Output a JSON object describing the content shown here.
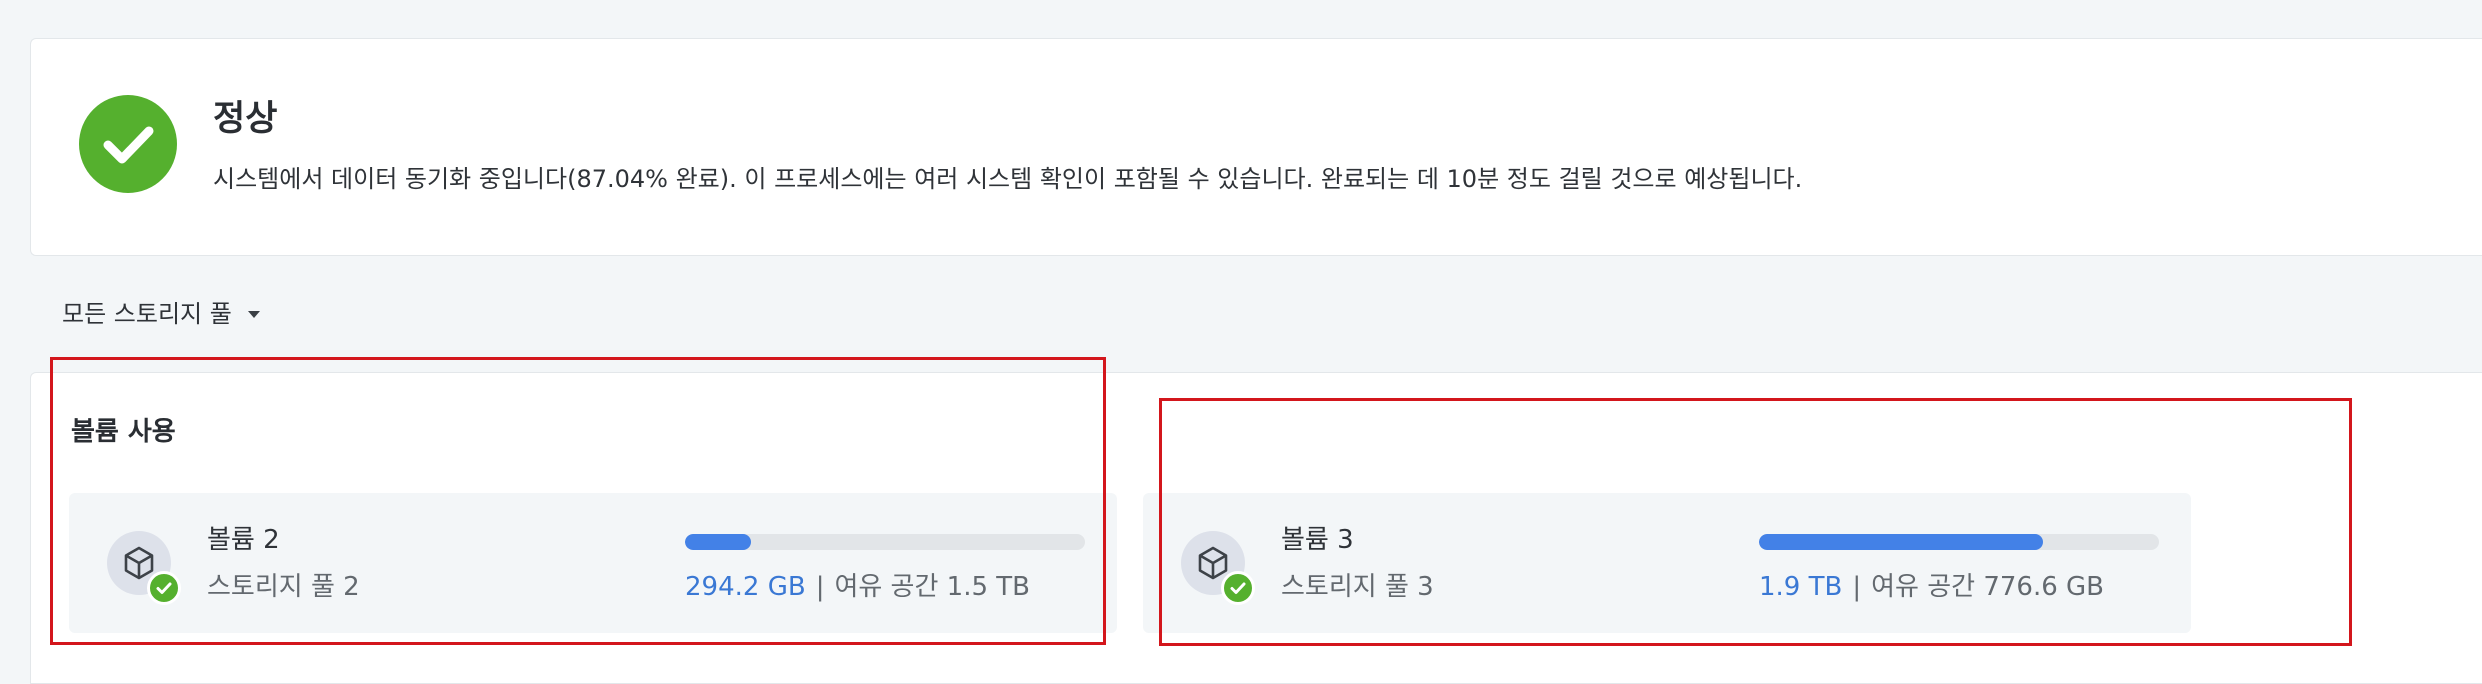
{
  "status": {
    "title": "정상",
    "description": "시스템에서 데이터 동기화 중입니다(87.04% 완료). 이 프로세스에는 여러 시스템 확인이 포함될 수 있습니다. 완료되는 데 10분 정도 걸릴 것으로 예상됩니다.",
    "icon": "check-circle-icon",
    "color": "#55b02e"
  },
  "filter": {
    "label": "모든 스토리지 풀",
    "icon": "caret-down-icon"
  },
  "usage": {
    "title": "볼륨 사용",
    "volumes": [
      {
        "name": "볼륨 2",
        "pool": "스토리지 풀 2",
        "used": "294.2 GB",
        "separator": "|",
        "free": "여유 공간 1.5 TB",
        "usage_fraction": 0.166,
        "icon": "volume-cube-icon",
        "status_icon": "check-badge-icon"
      },
      {
        "name": "볼륨 3",
        "pool": "스토리지 풀 3",
        "used": "1.9 TB",
        "separator": "|",
        "free": "여유 공간 776.6 GB",
        "usage_fraction": 0.71,
        "icon": "volume-cube-icon",
        "status_icon": "check-badge-icon"
      }
    ]
  },
  "colors": {
    "accent": "#4381e7",
    "used_text": "#3a78d4",
    "ok_green": "#55b02e",
    "highlight_red": "#d3161c"
  }
}
